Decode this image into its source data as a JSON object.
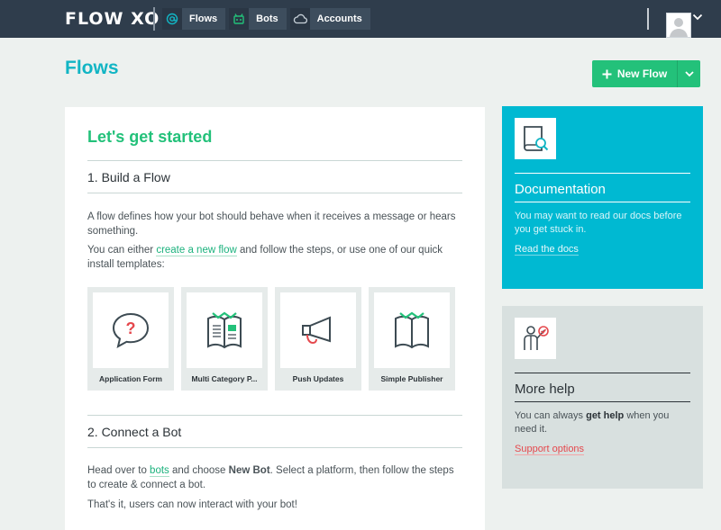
{
  "header": {
    "logo": "FLOW XO",
    "tabs": [
      {
        "label": "Flows",
        "icon": "at-icon"
      },
      {
        "label": "Bots",
        "icon": "bot-icon"
      },
      {
        "label": "Accounts",
        "icon": "cloud-icon"
      }
    ]
  },
  "page": {
    "title": "Flows",
    "new_flow_label": "New Flow"
  },
  "main": {
    "heading": "Let's get started",
    "step1": {
      "title": "1. Build a Flow",
      "para1": "A flow defines how your bot should behave when it receives a message or hears something.",
      "para2_before": "You can either ",
      "para2_link": "create a new flow",
      "para2_after": " and follow the steps, or use one of our quick install templates:"
    },
    "templates": [
      {
        "label": "Application Form",
        "icon": "question-bubble-icon"
      },
      {
        "label": "Multi Category P...",
        "icon": "catalog-book-icon"
      },
      {
        "label": "Push Updates",
        "icon": "megaphone-icon"
      },
      {
        "label": "Simple Publisher",
        "icon": "open-book-icon"
      }
    ],
    "step2": {
      "title": "2. Connect a Bot",
      "para1_before": "Head over to ",
      "para1_link": "bots",
      "para1_mid": " and choose ",
      "para1_bold": "New Bot",
      "para1_after": ". Select a platform, then follow the steps to create & connect a bot.",
      "para2": "That's it, users can now interact with your bot!"
    }
  },
  "documentation": {
    "title": "Documentation",
    "text": "You may want to read our docs before you get stuck in.",
    "link": "Read the docs"
  },
  "help": {
    "title": "More help",
    "text_before": "You can always ",
    "text_bold": "get help",
    "text_after": " when you need it.",
    "link": "Support options"
  },
  "colors": {
    "topbar": "#2f3d4c",
    "accent_teal": "#12b5c4",
    "accent_green": "#23c17a",
    "doc_card": "#00b9d2",
    "help_card": "#d8e0df",
    "support_link": "#e5484d"
  }
}
